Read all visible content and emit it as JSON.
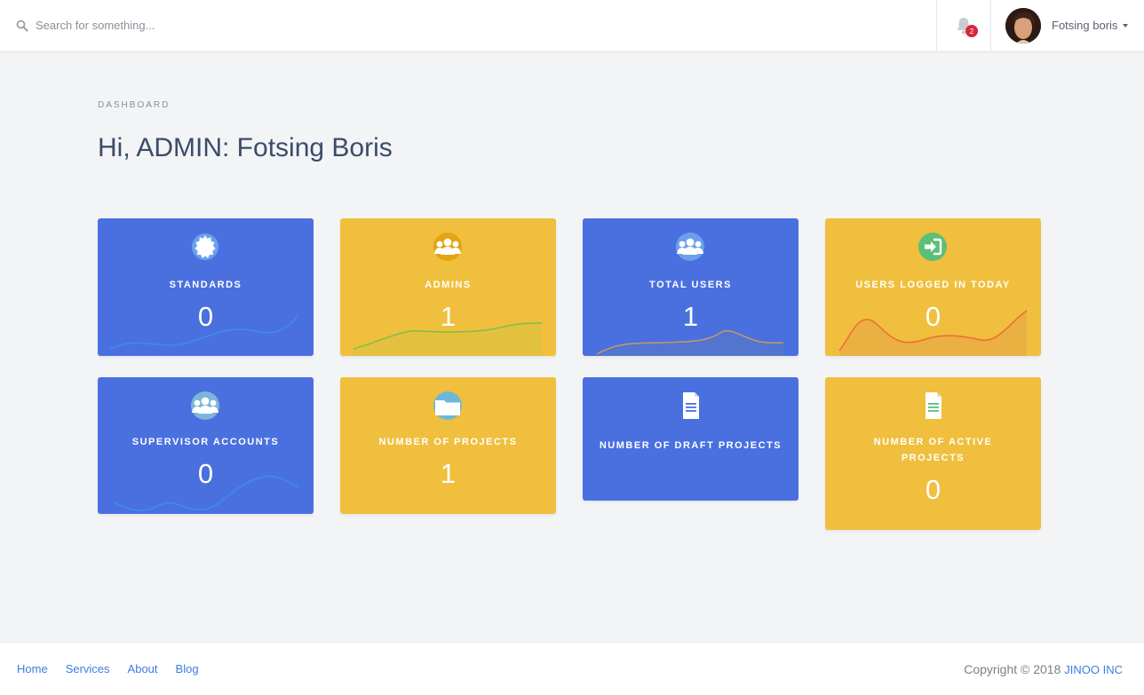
{
  "search": {
    "placeholder": "Search for something..."
  },
  "notifications": {
    "count": "2"
  },
  "user": {
    "name": "Fotsing boris"
  },
  "page": {
    "eyebrow": "DASHBOARD",
    "title": "Hi, ADMIN: Fotsing Boris"
  },
  "cards": [
    {
      "label": "STANDARDS",
      "value": "0",
      "color": "#4a70e0",
      "icon": "badge-icon"
    },
    {
      "label": "ADMINS",
      "value": "1",
      "color": "#f0bf3d",
      "icon": "users-icon"
    },
    {
      "label": "TOTAL USERS",
      "value": "1",
      "color": "#4a70e0",
      "icon": "users-icon"
    },
    {
      "label": "USERS LOGGED IN TODAY",
      "value": "0",
      "color": "#f0bf3d",
      "icon": "sign-in-icon"
    },
    {
      "label": "SUPERVISOR ACCOUNTS",
      "value": "0",
      "color": "#4a70e0",
      "icon": "users-icon"
    },
    {
      "label": "NUMBER OF PROJECTS",
      "value": "1",
      "color": "#f0bf3d",
      "icon": "folder-icon"
    },
    {
      "label": "NUMBER OF DRAFT PROJECTS",
      "value": "",
      "color": "#4a70e0",
      "icon": "document-icon"
    },
    {
      "label": "NUMBER OF ACTIVE PROJECTS",
      "value": "0",
      "color": "#f0bf3d",
      "icon": "document-icon"
    }
  ],
  "footer": {
    "links": [
      "Home",
      "Services",
      "About",
      "Blog"
    ],
    "copyright_prefix": "Copyright © 2018",
    "brand": "JINOO INC"
  }
}
